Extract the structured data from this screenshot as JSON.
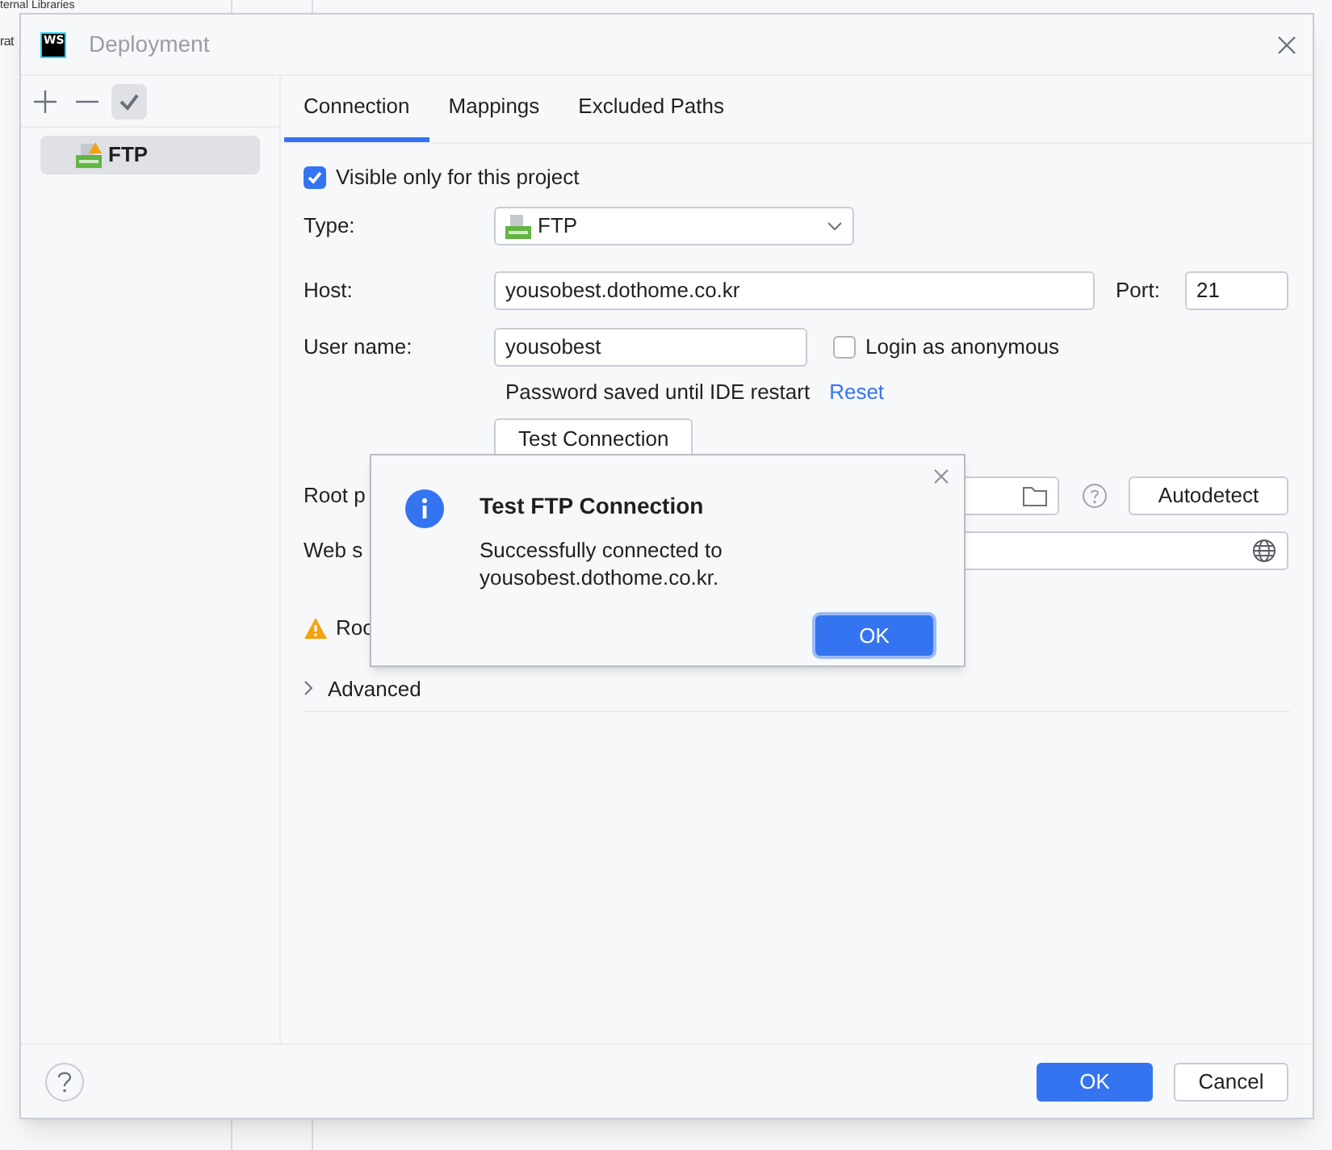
{
  "background": {
    "texts": [
      "ternal Libraries",
      "rat"
    ]
  },
  "window": {
    "logo": "WS",
    "title": "Deployment"
  },
  "toolbar": {
    "buttons": [
      {
        "kind": "add",
        "selected": false
      },
      {
        "kind": "remove",
        "selected": false
      },
      {
        "kind": "check",
        "selected": true
      }
    ]
  },
  "servers": [
    {
      "label": "FTP",
      "selected": true,
      "warning": true
    }
  ],
  "tabs": [
    {
      "label": "Connection",
      "selected": true
    },
    {
      "label": "Mappings",
      "selected": false
    },
    {
      "label": "Excluded Paths",
      "selected": false
    }
  ],
  "visible_only": {
    "label": "Visible only for this project",
    "checked": true
  },
  "type": {
    "label": "Type:",
    "value": "FTP"
  },
  "host": {
    "label": "Host:",
    "value": "yousobest.dothome.co.kr"
  },
  "port": {
    "label": "Port:",
    "value": "21"
  },
  "user": {
    "label": "User name:",
    "value": "yousobest"
  },
  "anonymous": {
    "label": "Login as anonymous",
    "checked": false
  },
  "password_note": {
    "text": "Password saved until IDE restart",
    "link": "Reset"
  },
  "test_button": "Test Connection",
  "root_path": {
    "label": "Root p"
  },
  "autodetect": "Autodetect",
  "web_server": {
    "label": "Web s"
  },
  "warning": "Roo",
  "advanced": {
    "label": "Advanced",
    "expanded": false
  },
  "popup": {
    "title": "Test FTP Connection",
    "message": "Successfully connected to yousobest.dothome.co.kr.",
    "button": "OK"
  },
  "footer": {
    "ok": "OK",
    "cancel": "Cancel"
  }
}
